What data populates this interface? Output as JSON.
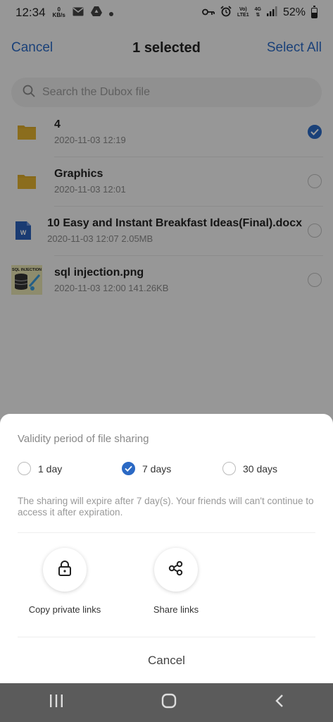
{
  "status_bar": {
    "time": "12:34",
    "speed_value": "0",
    "speed_unit": "KB/s",
    "volte_label": "Vo)",
    "lte_label": "LTE1",
    "net_type": "4G",
    "battery": "52%",
    "battery_level": 0.52
  },
  "top_bar": {
    "cancel_label": "Cancel",
    "title": "1 selected",
    "select_all_label": "Select All"
  },
  "search": {
    "placeholder": "Search the Dubox file"
  },
  "files": [
    {
      "name": "4",
      "meta": "2020-11-03  12:19",
      "icon": "folder-icon",
      "selected": true
    },
    {
      "name": "Graphics",
      "meta": "2020-11-03  12:01",
      "icon": "folder-icon",
      "selected": false
    },
    {
      "name": "10 Easy and Instant Breakfast Ideas(Final).docx",
      "meta": "2020-11-03  12:07   2.05MB",
      "icon": "word-doc-icon",
      "selected": false
    },
    {
      "name": "sql injection.png",
      "meta": "2020-11-03  12:00   141.26KB",
      "icon": "image-thumbnail",
      "selected": false
    }
  ],
  "sheet": {
    "title": "Validity period of file sharing",
    "options": [
      {
        "label": "1 day",
        "selected": false
      },
      {
        "label": "7 days",
        "selected": true
      },
      {
        "label": "30 days",
        "selected": false
      }
    ],
    "note": "The sharing will expire after 7 day(s). Your friends will can't continue to access it after expiration.",
    "actions": [
      {
        "label": "Copy private links",
        "icon": "lock-icon"
      },
      {
        "label": "Share links",
        "icon": "share-icon"
      }
    ],
    "cancel_label": "Cancel"
  },
  "thumb_text": "SQL INJECTION",
  "colors": {
    "accent": "#2b69c4",
    "folder": "#d9a82a",
    "word": "#2b5fb8"
  }
}
